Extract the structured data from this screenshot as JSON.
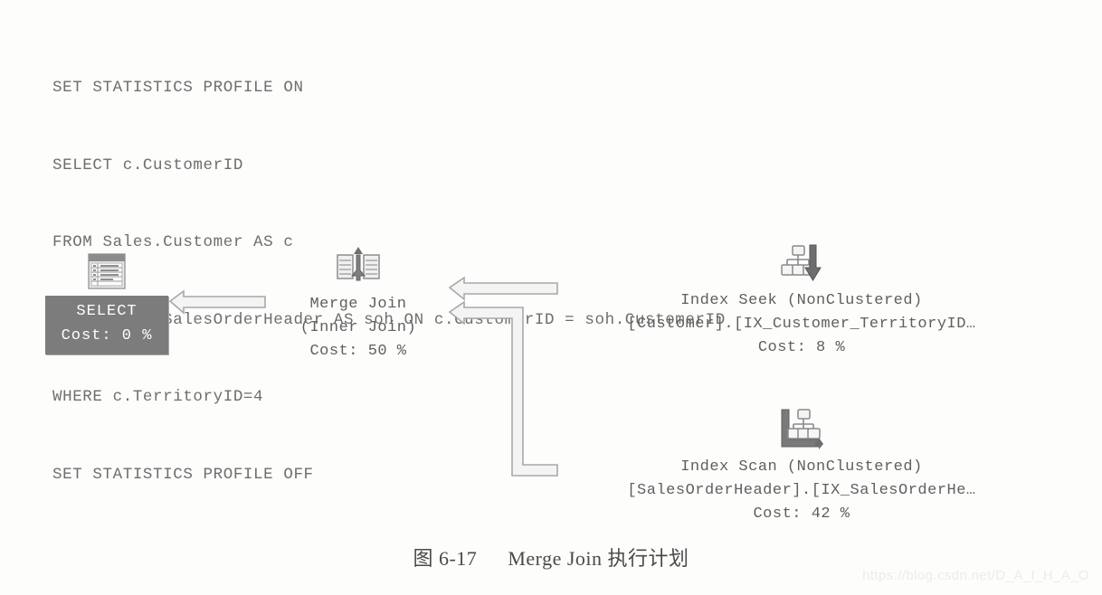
{
  "sql": {
    "lines": [
      "SET STATISTICS PROFILE ON",
      "SELECT c.CustomerID",
      "FROM Sales.Customer AS c",
      "JOIN Sales.SalesOrderHeader AS soh ON c.CustomerID = soh.CustomerID",
      "WHERE c.TerritoryID=4",
      "SET STATISTICS PROFILE OFF"
    ]
  },
  "plan": {
    "select_node": {
      "icon": "result-grid-icon",
      "label": "SELECT",
      "cost": "Cost: 0 %"
    },
    "merge_join_node": {
      "icon": "merge-join-icon",
      "label": "Merge Join",
      "subtitle": "(Inner Join)",
      "cost": "Cost: 50 %"
    },
    "index_seek_node": {
      "icon": "index-seek-icon",
      "label": "Index Seek (NonClustered)",
      "object": "[Customer].[IX_Customer_TerritoryID…",
      "cost": "Cost: 8 %"
    },
    "index_scan_node": {
      "icon": "index-scan-icon",
      "label": "Index Scan (NonClustered)",
      "object": "[SalesOrderHeader].[IX_SalesOrderHe…",
      "cost": "Cost: 42 %"
    },
    "colors": {
      "select_box_background": "#7c7c7c",
      "select_box_text": "#ffffff",
      "node_text": "#5f5f5f",
      "arrow_fill": "#f2f2f2",
      "arrow_stroke": "#a8a8a8",
      "code_text": "#6e6e6e"
    }
  },
  "caption": {
    "figure_number": "图 6-17",
    "title": "Merge Join 执行计划"
  },
  "watermark": {
    "text": "https://blog.csdn.net/D_A_I_H_A_O"
  }
}
